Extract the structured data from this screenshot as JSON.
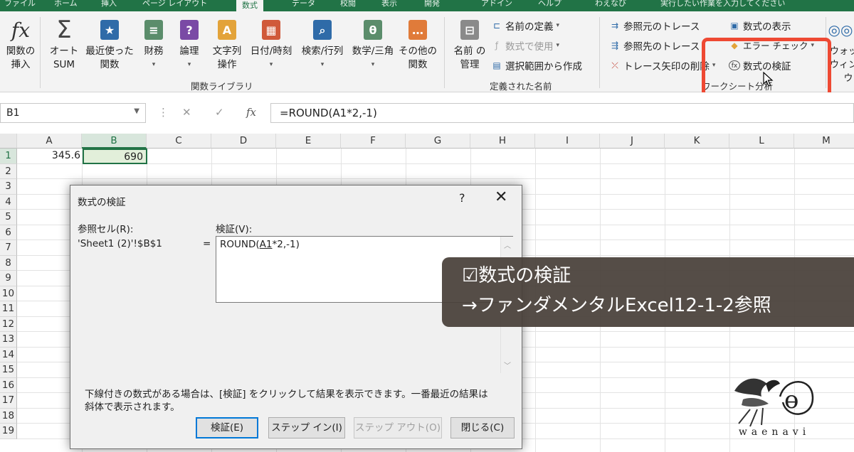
{
  "tabs": {
    "file": "ファイル",
    "home": "ホーム",
    "insert": "挿入",
    "layout": "ページ レイアウト",
    "formulas": "数式",
    "data": "データ",
    "review": "校閲",
    "view": "表示",
    "developer": "開発",
    "addin": "アドイン",
    "help": "ヘルプ",
    "waenavi": "わえなび",
    "tellme": "実行したい作業を入力してください"
  },
  "ribbon": {
    "insert_fn": "関数の挿入",
    "autosum": "オート SUM",
    "recent": "最近使った 関数",
    "financial": "財務",
    "logical": "論理",
    "text": "文字列 操作",
    "datetime": "日付/時刻",
    "lookup": "検索/行列",
    "math": "数学/三角",
    "other": "その他の 関数",
    "group_library": "関数ライブラリ",
    "name_manager": "名前 の管理",
    "define_name": "名前の定義",
    "use_in_formula": "数式で使用",
    "create_from_selection": "選択範囲から作成",
    "group_names": "定義された名前",
    "trace_precedents": "参照元のトレース",
    "trace_dependents": "参照先のトレース",
    "remove_arrows": "トレース矢印の削除",
    "show_formulas": "数式の表示",
    "error_check": "エラー チェック",
    "evaluate_formula": "数式の検証",
    "group_audit": "ワークシート分析",
    "watch_window": "ウォッチ ウィンドウ"
  },
  "formula_bar": {
    "name_box": "B1",
    "formula": "=ROUND(A1*2,-1)",
    "fx": "fx"
  },
  "sheet": {
    "columns": [
      "A",
      "B",
      "C",
      "D",
      "E",
      "F",
      "G",
      "H",
      "I",
      "J",
      "K",
      "L",
      "M"
    ],
    "rows": [
      "1",
      "2",
      "3",
      "4",
      "5",
      "6",
      "7",
      "8",
      "9",
      "10",
      "11",
      "12",
      "13",
      "14",
      "15",
      "16",
      "17",
      "18",
      "19"
    ],
    "a1": "345.6",
    "b1": "690"
  },
  "dialog": {
    "title": "数式の検証",
    "help": "?",
    "close": "✕",
    "ref_label": "参照セル(R):",
    "ref_value": "'Sheet1 (2)'!$B$1",
    "eq": "=",
    "eval_label": "検証(V):",
    "eval_prefix": "ROUND(",
    "eval_underlined": "A1",
    "eval_suffix": "*2,-1)",
    "hint1": "下線付きの数式がある場合は、[検証] をクリックして結果を表示できます。一番最近の結果は",
    "hint2": "斜体で表示されます。",
    "btn_evaluate": "検証(E)",
    "btn_step_in": "ステップ イン(I)",
    "btn_step_out": "ステップ アウト(O)",
    "btn_close": "閉じる(C)"
  },
  "overlay": {
    "line1": "☑数式の検証",
    "line2": "→ファンダメンタルExcel12-1-2参照"
  },
  "logo": {
    "text": "waenavi"
  },
  "colors": {
    "excel_green": "#217346",
    "highlight": "#ee4933"
  }
}
